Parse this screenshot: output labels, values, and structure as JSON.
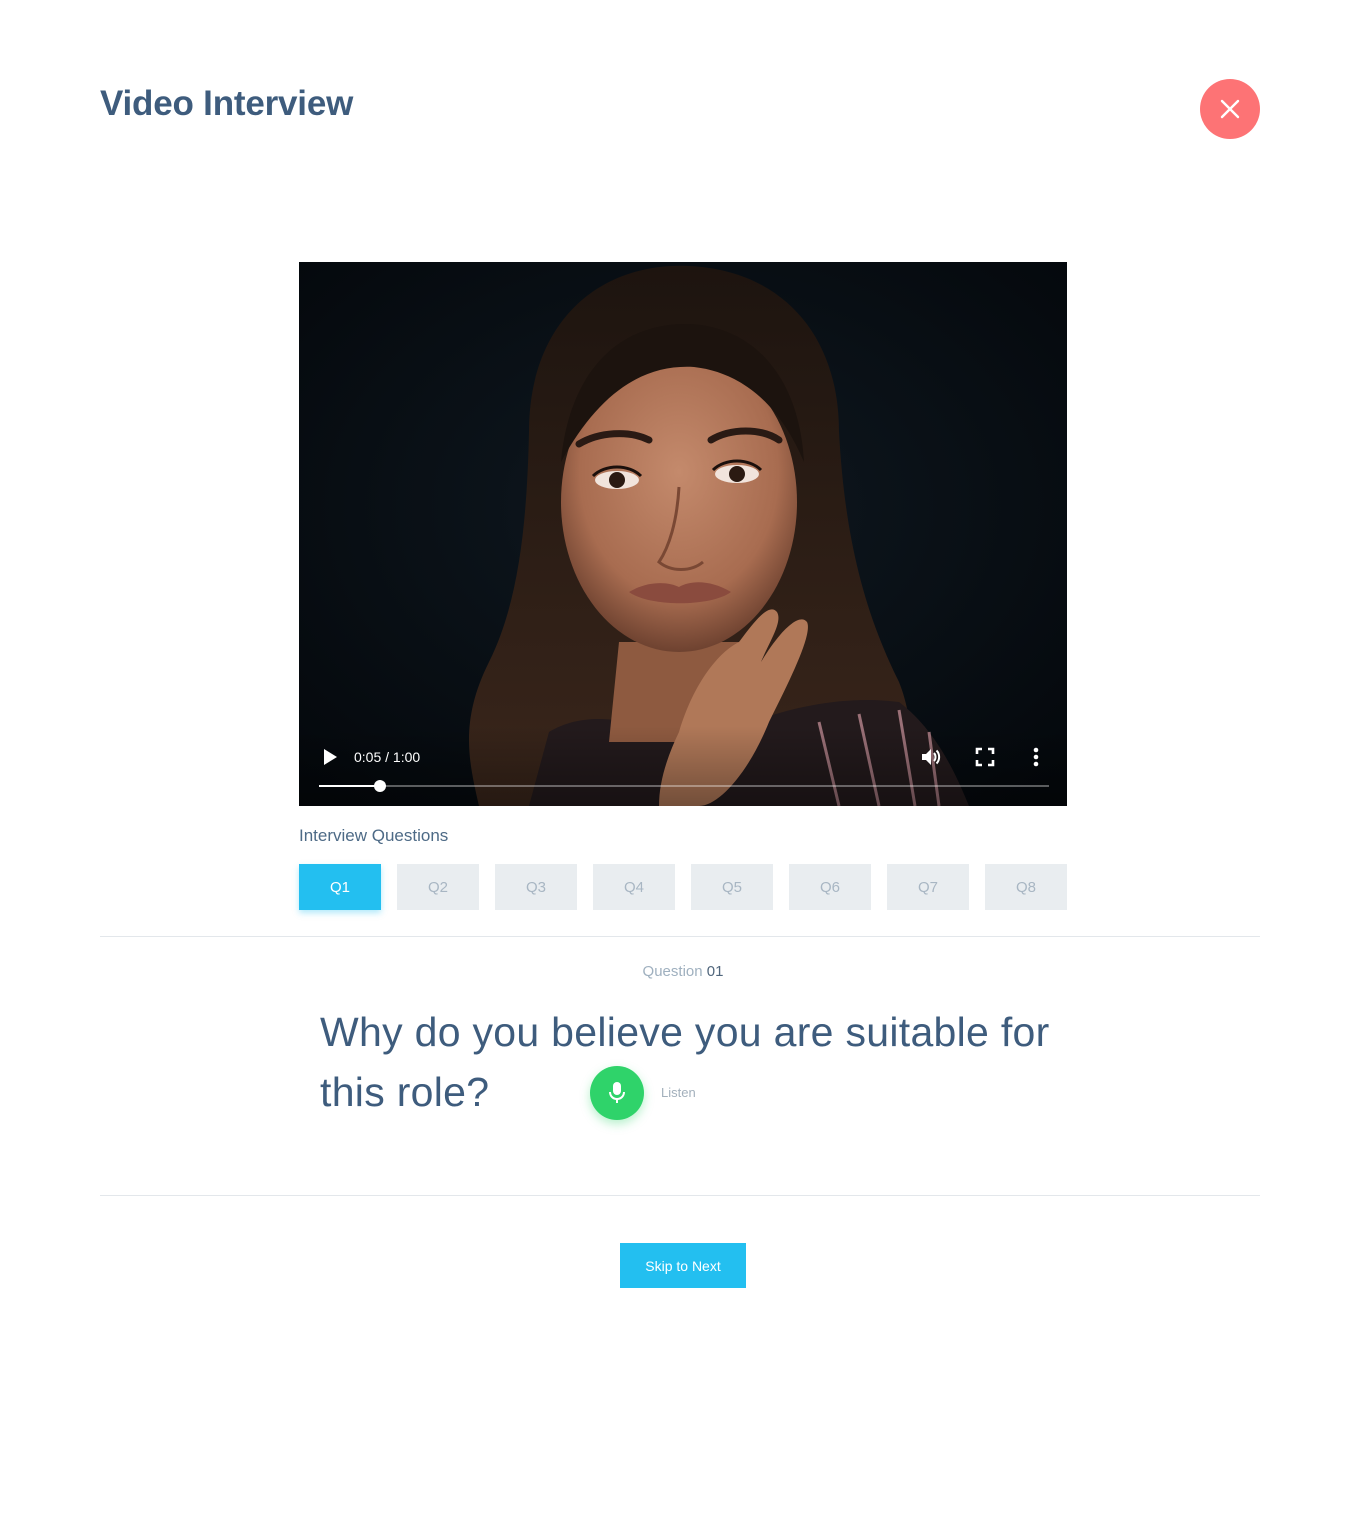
{
  "header": {
    "title": "Video Interview",
    "close_icon": "close-icon"
  },
  "video": {
    "current_time": "0:05",
    "duration": "1:00",
    "time_display": "0:05 / 1:00",
    "progress_fraction": 0.0833,
    "icons": [
      "play-icon",
      "volume-icon",
      "fullscreen-icon",
      "more-vert-icon"
    ]
  },
  "questions": {
    "section_label": "Interview Questions",
    "tabs": [
      {
        "label": "Q1",
        "active": true
      },
      {
        "label": "Q2",
        "active": false
      },
      {
        "label": "Q3",
        "active": false
      },
      {
        "label": "Q4",
        "active": false
      },
      {
        "label": "Q5",
        "active": false
      },
      {
        "label": "Q6",
        "active": false
      },
      {
        "label": "Q7",
        "active": false
      },
      {
        "label": "Q8",
        "active": false
      }
    ]
  },
  "current_question": {
    "label": "Question",
    "number": "01",
    "text": "Why do you believe you are suitable for this role?",
    "listen_label": "Listen"
  },
  "footer": {
    "skip_label": "Skip to Next"
  },
  "colors": {
    "title": "#3e5c7d",
    "close": "#fd7375",
    "accent": "#23bff0",
    "mic": "#2fd36a",
    "tab_inactive": "#e9edf0"
  }
}
